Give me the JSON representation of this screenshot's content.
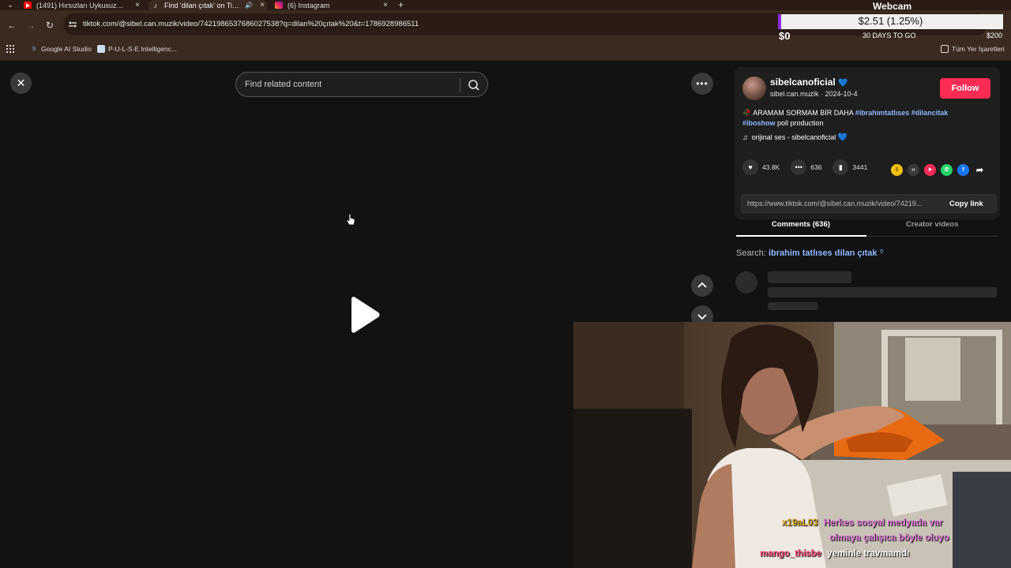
{
  "browser": {
    "tabs": [
      {
        "title": "(1491) Hırsızları Uykusuz Bırakan",
        "icon": "youtube-icon",
        "active": false
      },
      {
        "title": "Find 'dilan çıtak' on TikTok",
        "icon": "tiktok-icon",
        "active": true,
        "audio": true
      },
      {
        "title": "(6) Instagram",
        "icon": "instagram-icon",
        "active": false
      }
    ],
    "new_tab": "+",
    "url": "tiktok.com/@sibel.can.muzik/video/7421986537686027538?q=dilan%20çıtak%20&t=1786928986511",
    "bookmarks": [
      {
        "label": "Google AI Studio",
        "icon": "ai-studio-icon"
      },
      {
        "label": "P-U-L-S-E Intelligenc...",
        "icon": "pulse-icon"
      }
    ],
    "all_bookmarks": "Tüm Yer İşaretleri"
  },
  "donation": {
    "label": "Webcam",
    "amount": "$2.51 (1.25%)",
    "progress_percent": 1.25,
    "min": "$0",
    "days": "30 DAYS TO GO",
    "max": "$200",
    "fill_color": "#8b2be2"
  },
  "tiktok": {
    "search_placeholder": "Find related content",
    "author": {
      "username": "sibelcanoficial",
      "handle_date": "sibel.can.muzik · 2024-10-4",
      "follow_label": "Follow"
    },
    "caption": {
      "prefix": "🥀 ARAMAM SORMAM BİR DAHA",
      "hashtags": [
        "#ibrahimtatlıses",
        "#dilancitak",
        "#iboshow"
      ],
      "suffix": "poll production"
    },
    "music": "orijinal ses - sibelcanoficial",
    "stats": {
      "likes": "43.8K",
      "comments": "636",
      "saves": "3441"
    },
    "share_icons": [
      "coin-icon",
      "embed-icon",
      "send-icon",
      "whatsapp-icon",
      "facebook-icon",
      "share-arrow-icon"
    ],
    "link": "https://www.tiktok.com/@sibel.can.muzik/video/74219...",
    "copy_label": "Copy link",
    "tabs": [
      "Comments (636)",
      "Creator videos"
    ],
    "search_prefix": "Search:",
    "search_term": "ibrahim tatlıses dilan çıtak",
    "accent": "#fe2c55"
  },
  "chat": [
    {
      "user": "x19aL03",
      "message": "Herkes sosyal medyada var",
      "user_color": "#d4a017",
      "msg_color": "#e07ad8"
    },
    {
      "user": "",
      "message": "olmaya çalışıca böyle oluyo",
      "user_color": "#d4a017",
      "msg_color": "#e07ad8"
    },
    {
      "user": "mango_thisbe",
      "message": "yeminle travmamdı",
      "user_color": "#ff4f7a",
      "msg_color": "#ffffff"
    }
  ]
}
